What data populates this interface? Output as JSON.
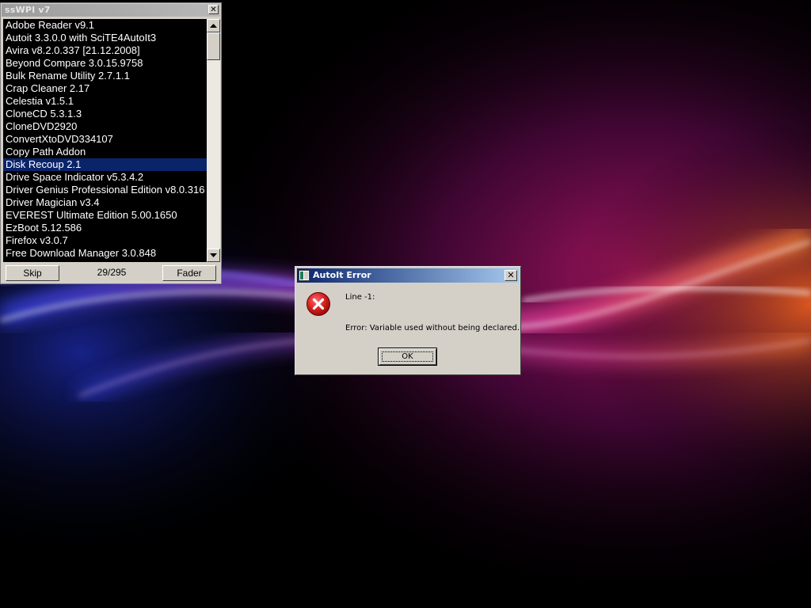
{
  "sswpi_window": {
    "title": "ssWPI v7",
    "close_glyph": "✕",
    "list_items": [
      "Adobe Reader v9.1",
      "Autoit 3.3.0.0 with SciTE4AutoIt3",
      "Avira v8.2.0.337 [21.12.2008]",
      "Beyond Compare 3.0.15.9758",
      "Bulk Rename Utility 2.7.1.1",
      "Crap Cleaner 2.17",
      "Celestia v1.5.1",
      "CloneCD 5.3.1.3",
      "CloneDVD2920",
      "ConvertXtoDVD334107",
      "Copy Path Addon",
      "Disk Recoup 2.1",
      "Drive Space Indicator v5.3.4.2",
      "Driver Genius Professional Edition v8.0.316",
      "Driver Magician v3.4",
      "EVEREST Ultimate Edition 5.00.1650",
      "EzBoot 5.12.586",
      "Firefox v3.0.7",
      "Free Download Manager 3.0.848"
    ],
    "selected_item": "Disk Recoup 2.1",
    "skip_label": "Skip",
    "progress": "29/295",
    "fader_label": "Fader"
  },
  "error_dialog": {
    "title": "AutoIt Error",
    "close_glyph": "✕",
    "line_text": "Line -1:",
    "message": "Error: Variable used without being declared.",
    "ok_label": "OK"
  },
  "colors": {
    "selection": "#0a246a",
    "dialog_title_start": "#0a246a",
    "dialog_title_end": "#a6caf0",
    "error_red": "#c8102e",
    "face": "#d4d0c8"
  },
  "icons": {
    "error": "error-x-icon",
    "app": "autoit-app-icon",
    "scroll_up": "arrow-up-icon",
    "scroll_down": "arrow-down-icon"
  }
}
